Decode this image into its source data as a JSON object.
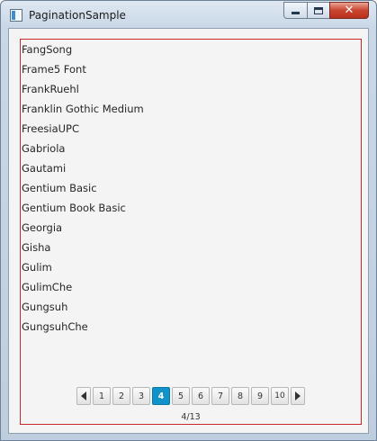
{
  "window": {
    "title": "PaginationSample",
    "caption_icons": {
      "minimize": "minimize-icon",
      "maximize": "maximize-icon",
      "close": "close-icon"
    },
    "close_glyph": "✕"
  },
  "font_list": [
    "FangSong",
    "Frame5 Font",
    "FrankRuehl",
    "Franklin Gothic Medium",
    "FreesiaUPC",
    "Gabriola",
    "Gautami",
    "Gentium Basic",
    "Gentium Book Basic",
    "Georgia",
    "Gisha",
    "Gulim",
    "GulimChe",
    "Gungsuh",
    "GungsuhChe"
  ],
  "pagination": {
    "pages": [
      "1",
      "2",
      "3",
      "4",
      "5",
      "6",
      "7",
      "8",
      "9",
      "10"
    ],
    "current_page": "4",
    "page_info": "4/13",
    "prev_icon": "chevron-left-icon",
    "next_icon": "chevron-right-icon",
    "active_color": "#0f93c8",
    "frame_border_color": "#c8282a"
  }
}
